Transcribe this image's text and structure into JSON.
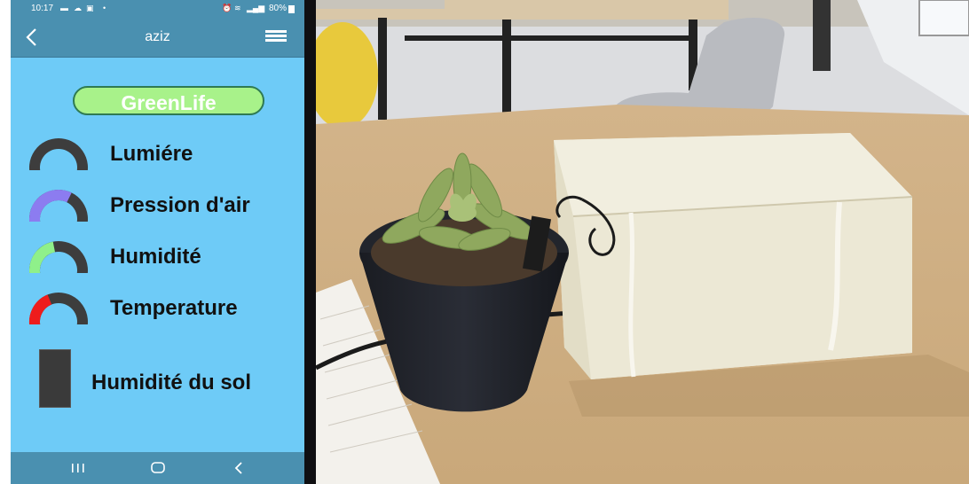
{
  "status_bar": {
    "time": "10:17",
    "battery": "80%",
    "icons": [
      "image-icon",
      "cloud-icon",
      "app-icon",
      "dot-icon",
      "alarm-icon",
      "wifi-icon",
      "signal-icon",
      "battery-icon"
    ]
  },
  "app_bar": {
    "title": "aziz",
    "back_icon": "chevron-left-icon",
    "menu_icon": "hamburger-menu-icon"
  },
  "brand": {
    "label": "GreenLife",
    "fill_color": "#a8f28a",
    "border_color": "#2f7a52"
  },
  "sensors": [
    {
      "label": "Lumiére",
      "gauge_color": "#3d3d3d",
      "fill_color": "#3d3d3d",
      "level": 0
    },
    {
      "label": "Pression d'air",
      "gauge_color": "#3d3d3d",
      "fill_color": "#8c7cf0",
      "level": 0.62
    },
    {
      "label": "Humidité",
      "gauge_color": "#3d3d3d",
      "fill_color": "#8ff08a",
      "level": 0.45
    },
    {
      "label": "Temperature",
      "gauge_color": "#3d3d3d",
      "fill_color": "#ee1c1c",
      "level": 0.4
    }
  ],
  "soil": {
    "label": "Humidité du sol",
    "level": 0
  },
  "nav_bar": {
    "icons": [
      "recent-apps-icon",
      "home-icon",
      "back-icon"
    ]
  },
  "colors": {
    "screen_bg": "#6ecbf7",
    "bar_bg": "#4a90b0"
  },
  "photo": {
    "description_visible": false
  }
}
